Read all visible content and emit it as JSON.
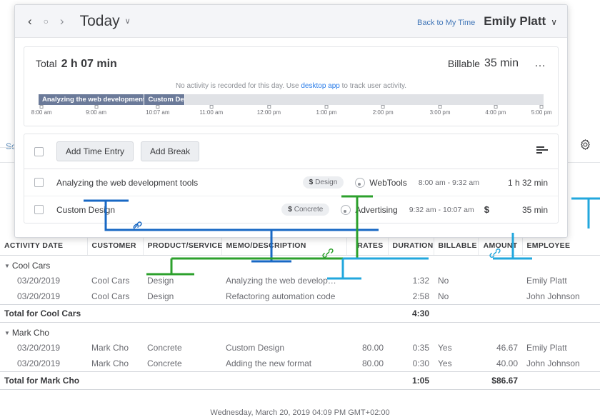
{
  "modal": {
    "nav": {
      "back": "‹",
      "dot": "○",
      "forward": "›"
    },
    "title": "Today",
    "title_caret": "∨",
    "back_link": "Back to My Time",
    "user_name": "Emily Platt",
    "user_caret": "∨",
    "summary": {
      "total_label": "Total",
      "total_value": "2 h 07 min",
      "billable_label": "Billable",
      "billable_value": "35 min",
      "more_label": "…"
    },
    "activity_note": {
      "before": "No activity is recorded for this day. Use ",
      "link": "desktop app",
      "after": " to track user activity."
    },
    "timeline": {
      "segments": [
        {
          "label": "Analyzing the web development",
          "left_pct": 0.0,
          "width_pct": 21.0
        },
        {
          "label": "Custom De",
          "left_pct": 21.0,
          "width_pct": 8.0
        }
      ],
      "ticks": [
        {
          "label": "8:00 am",
          "pos_pct": 0.6
        },
        {
          "label": "9:00 am",
          "pos_pct": 11.4
        },
        {
          "label": "10:07 am",
          "pos_pct": 23.6
        },
        {
          "label": "11:00 am",
          "pos_pct": 34.2
        },
        {
          "label": "12:00 pm",
          "pos_pct": 45.6
        },
        {
          "label": "1:00 pm",
          "pos_pct": 57.0
        },
        {
          "label": "2:00 pm",
          "pos_pct": 68.2
        },
        {
          "label": "3:00 pm",
          "pos_pct": 79.5
        },
        {
          "label": "4:00 pm",
          "pos_pct": 90.5
        },
        {
          "label": "5:00 pm",
          "pos_pct": 99.6
        }
      ]
    },
    "toolbar": {
      "add_time_entry": "Add Time Entry",
      "add_break": "Add Break"
    },
    "entries": [
      {
        "description": "Analyzing the web development tools",
        "service_currency": "$",
        "service": "Design",
        "customer": "WebTools",
        "time_range": "8:00 am - 9:32 am",
        "billable_marker": "",
        "duration": "1 h 32 min"
      },
      {
        "description": "Custom Design",
        "service_currency": "$",
        "service": "Concrete",
        "customer": "Advertising",
        "time_range": "9:32 am - 10:07 am",
        "billable_marker": "$",
        "duration": "35 min"
      }
    ]
  },
  "background": {
    "left_label": "Sc",
    "export_icon": "export-icon",
    "gear_icon": "gear-icon"
  },
  "report": {
    "columns": [
      "ACTIVITY DATE",
      "CUSTOMER",
      "PRODUCT/SERVICE",
      "MEMO/DESCRIPTION",
      "RATES",
      "DURATION",
      "BILLABLE",
      "AMOUNT",
      "EMPLOYEE"
    ],
    "groups": [
      {
        "name": "Cool Cars",
        "rows": [
          {
            "date": "03/20/2019",
            "customer": "Cool Cars",
            "product": "Design",
            "memo": "Analyzing the web developm…",
            "rate": "",
            "duration": "1:32",
            "billable": "No",
            "amount": "",
            "employee": "Emily Platt"
          },
          {
            "date": "03/20/2019",
            "customer": "Cool Cars",
            "product": "Design",
            "memo": "Refactoring automation code",
            "rate": "",
            "duration": "2:58",
            "billable": "No",
            "amount": "",
            "employee": "John Johnson"
          }
        ],
        "total_label": "Total for Cool Cars",
        "total_duration": "4:30",
        "total_amount": ""
      },
      {
        "name": "Mark Cho",
        "rows": [
          {
            "date": "03/20/2019",
            "customer": "Mark Cho",
            "product": "Concrete",
            "memo": "Custom Design",
            "rate": "80.00",
            "duration": "0:35",
            "billable": "Yes",
            "amount": "46.67",
            "employee": "Emily Platt"
          },
          {
            "date": "03/20/2019",
            "customer": "Mark Cho",
            "product": "Concrete",
            "memo": "Adding the new format",
            "rate": "80.00",
            "duration": "0:30",
            "billable": "Yes",
            "amount": "40.00",
            "employee": "John Johnson"
          }
        ],
        "total_label": "Total for Mark Cho",
        "total_duration": "1:05",
        "total_amount": "$86.67"
      }
    ],
    "footer": "Wednesday, March 20, 2019  04:09 PM GMT+02:00"
  },
  "annotations": {
    "green_color": "#2ca02c",
    "blue_color": "#1868c4",
    "cyan_color": "#22a7dd",
    "link_icon": "link-icon"
  }
}
